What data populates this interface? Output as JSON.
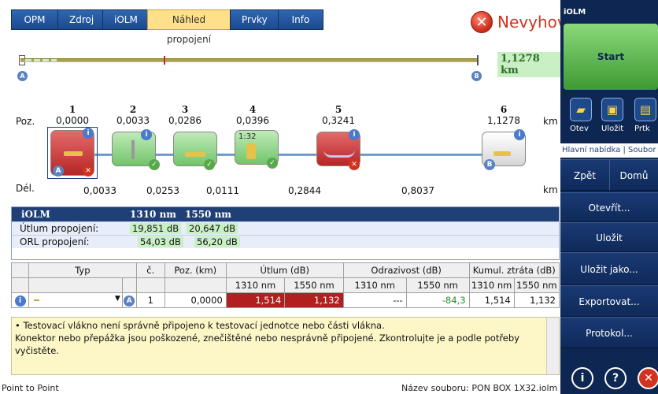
{
  "tabs": [
    "OPM",
    "Zdroj",
    "iOLM",
    "Náhled propojení",
    "Prvky",
    "Info"
  ],
  "status_title": "Nevyhov",
  "link": {
    "total_km": "1,1278 km",
    "label_a": "A",
    "label_b": "B"
  },
  "positions": {
    "label": "Poz.",
    "unit": "km",
    "items": [
      {
        "n": "1",
        "v": "0,0000"
      },
      {
        "n": "2",
        "v": "0,0033"
      },
      {
        "n": "3",
        "v": "0,0286"
      },
      {
        "n": "4",
        "v": "0,0396"
      },
      {
        "n": "5",
        "v": "0,3241"
      },
      {
        "n": "6",
        "v": "1,1278"
      }
    ]
  },
  "splitter_label": "1:32",
  "lengths": {
    "label": "Dél.",
    "unit": "km",
    "values": [
      "0,0033",
      "0,0253",
      "0,0111",
      "0,2844",
      "0,8037"
    ]
  },
  "iolm": {
    "title": "iOLM",
    "w1": "1310 nm",
    "w2": "1550 nm",
    "rows": [
      {
        "label": "Útlum propojení:",
        "v1": "19,851 dB",
        "v2": "20,647 dB"
      },
      {
        "label": "ORL propojení:",
        "v1": "54,03 dB",
        "v2": "56,20 dB"
      }
    ]
  },
  "evt": {
    "h_typ": "Typ",
    "h_c": "č.",
    "h_poz": "Poz. (km)",
    "h_utlum": "Útlum (dB)",
    "h_odraz": "Odrazivost (dB)",
    "h_kumul": "Kumul. ztráta (dB)",
    "w1": "1310 nm",
    "w2": "1550 nm",
    "row": {
      "c": "1",
      "poz": "0,0000",
      "u1": "1,514",
      "u2": "1,132",
      "o1": "---",
      "o2": "-84,3",
      "k1": "1,514",
      "k2": "1,132"
    }
  },
  "message": {
    "line1": "• Testovací vlákno není správně připojeno k testovací jednotce nebo části vlákna.",
    "line2": "Konektor nebo přepážka jsou poškozené, znečištěné nebo nesprávně připojené. Zkontrolujte je a podle potřeby",
    "line3": "vyčistěte."
  },
  "statusbar": {
    "left": "Point to Point",
    "right": "Název souboru: PON BOX 1X32.iolm"
  },
  "sidebar": {
    "title": "iOLM",
    "start": "Start",
    "tb": [
      "Otev",
      "Uložit",
      "Prtk"
    ],
    "menu_path": "Hlavní nabídka | Soubor",
    "back": "Zpět",
    "home": "Domů",
    "items": [
      "Otevřít...",
      "Uložit",
      "Uložit jako...",
      "Exportovat...",
      "Protokol..."
    ]
  },
  "colors": {
    "accent": "#1f3f77",
    "fail": "#d2331f",
    "pass": "#5aa84c",
    "highlight": "#c9efc5"
  }
}
